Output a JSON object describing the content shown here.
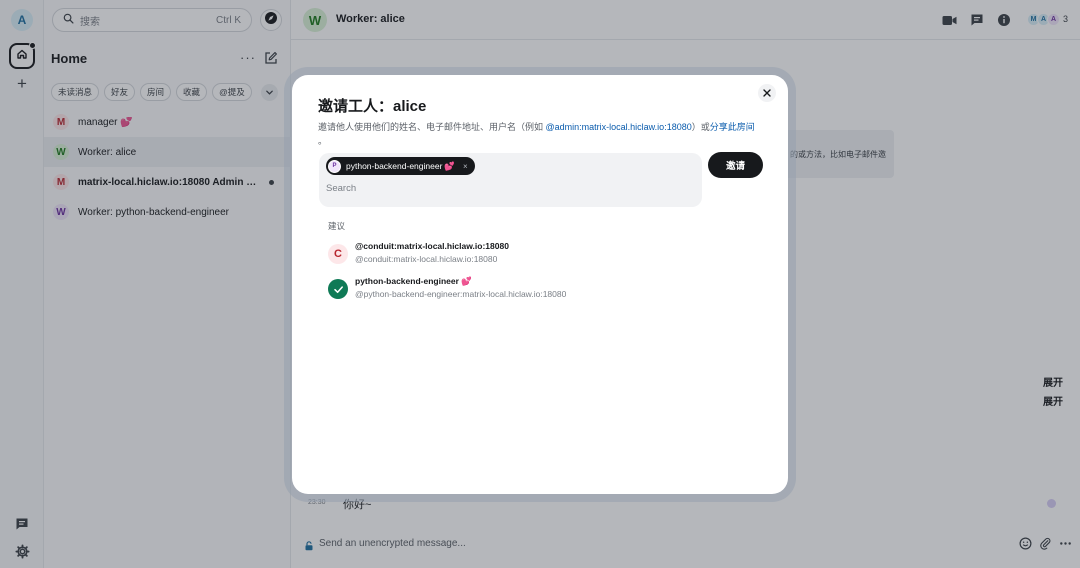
{
  "rail": {
    "account_initial": "A",
    "account_color": "#1d6fa0",
    "home_icon": "home-icon",
    "create_space_label": "+",
    "threads_icon": "threads-icon",
    "settings_icon": "gear-icon"
  },
  "roomlist": {
    "search_placeholder": "搜索",
    "search_shortcut": "Ctrl K",
    "explore_icon": "compass-icon",
    "title": "Home",
    "more_label": "···",
    "compose_icon": "compose-icon",
    "filters": [
      "未读消息",
      "好友",
      "房间",
      "收藏",
      "@提及"
    ],
    "filters_toggle_icon": "chevron-down-icon",
    "rooms": [
      {
        "initial": "M",
        "name": "manager",
        "emoji": "💕",
        "bold": false,
        "selected": false,
        "unread": false,
        "avatar_bg": "#fde7e9",
        "avatar_fg": "#b8262f"
      },
      {
        "initial": "W",
        "name": "Worker: alice",
        "emoji": "",
        "bold": false,
        "selected": true,
        "unread": false,
        "avatar_bg": "#d9f2d6",
        "avatar_fg": "#1e7a1e"
      },
      {
        "initial": "M",
        "name": "matrix-local.hiclaw.io:18080 Admin R...",
        "emoji": "",
        "bold": true,
        "selected": false,
        "unread": true,
        "avatar_bg": "#fde7e9",
        "avatar_fg": "#b8262f"
      },
      {
        "initial": "W",
        "name": "Worker: python-backend-engineer",
        "emoji": "",
        "bold": false,
        "selected": false,
        "unread": false,
        "avatar_bg": "#f0e6fa",
        "avatar_fg": "#6b2fa0"
      }
    ]
  },
  "room": {
    "avatar_initial": "W",
    "title": "Worker: alice",
    "header_icons": [
      "video-call-icon",
      "threads-icon",
      "room-info-icon"
    ],
    "facepile": [
      {
        "initial": "M",
        "bg": "#d8eef8",
        "fg": "#1d6fa0"
      },
      {
        "initial": "A",
        "bg": "#d8eef8",
        "fg": "#1d6fa0"
      },
      {
        "initial": "A",
        "bg": "#f0e6fa",
        "fg": "#6b2fa0"
      }
    ],
    "member_count": "3",
    "notice_text": "的或方法，比如电子邮件邀",
    "expand_labels": [
      "展开",
      "展开"
    ],
    "message_time": "23:30",
    "message_text": "你好~",
    "composer_placeholder": "Send an unencrypted message...",
    "composer_icons": [
      "emoji-icon",
      "attachment-icon",
      "more-icon"
    ]
  },
  "dialog": {
    "title": "邀请工人：alice",
    "desc_prefix": "邀请他人使用他们的姓名、电子邮件地址、用户名（例如 ",
    "desc_example": "@admin:matrix-local.hiclaw.io:18080",
    "desc_middle": "）或",
    "desc_link": "分享此房间",
    "desc_suffix": " 。",
    "pill": {
      "initial": "P",
      "label": "python-backend-engineer",
      "emoji": "💕",
      "remove": "×"
    },
    "search_placeholder": "Search",
    "invite_label": "邀请",
    "close_icon": "close-icon",
    "suggestions_heading": "建议",
    "suggestions": [
      {
        "initial": "C",
        "name": "@conduit:matrix-local.hiclaw.io:18080",
        "emoji": "",
        "id": "@conduit:matrix-local.hiclaw.io:18080",
        "selected": false,
        "avatar_bg": "#fde7e9",
        "avatar_fg": "#b8262f"
      },
      {
        "initial": "",
        "name": "python-backend-engineer",
        "emoji": "💕",
        "id": "@python-backend-engineer:matrix-local.hiclaw.io:18080",
        "selected": true,
        "avatar_bg": "#0f7a56",
        "avatar_fg": "#ffffff"
      }
    ]
  }
}
